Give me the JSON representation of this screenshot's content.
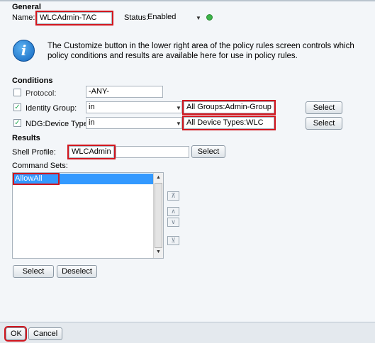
{
  "general": {
    "heading": "General",
    "name_label": "Name:",
    "name_value": "WLCAdmin-TAC",
    "status_label": "Status:",
    "status_value": "Enabled",
    "status_color": "#3db54a"
  },
  "info": {
    "icon": "info-icon",
    "text_line1": "The Customize button in the lower right area of the policy rules screen controls which",
    "text_line2": "policy conditions and results are available here for use in policy rules."
  },
  "conditions": {
    "heading": "Conditions",
    "rows": [
      {
        "label": "Protocol:",
        "checked": false,
        "operator": "",
        "value": "-ANY-",
        "select_label": ""
      },
      {
        "label": "Identity Group:",
        "checked": true,
        "operator": "in",
        "value": "All Groups:Admin-Group",
        "select_label": "Select"
      },
      {
        "label": "NDG:Device Type:",
        "checked": true,
        "operator": "in",
        "value": "All Device Types:WLC",
        "select_label": "Select"
      }
    ]
  },
  "results": {
    "heading": "Results",
    "shell_profile_label": "Shell Profile:",
    "shell_profile_value": "WLCAdmin",
    "shell_select_label": "Select",
    "command_sets_label": "Command Sets:",
    "command_sets": [
      "AllowAll"
    ],
    "select_label": "Select",
    "deselect_label": "Deselect"
  },
  "footer": {
    "ok_label": "OK",
    "cancel_label": "Cancel"
  }
}
